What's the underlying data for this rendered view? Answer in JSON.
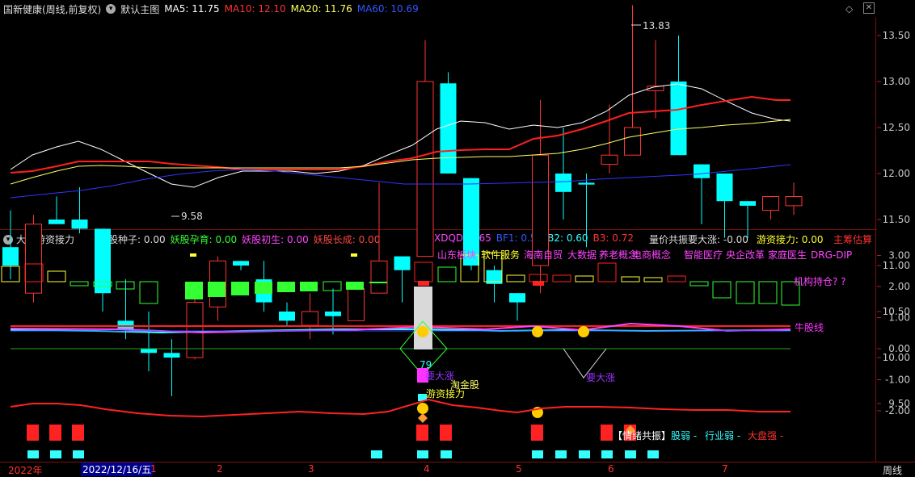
{
  "main": {
    "title": "国新健康(周线,前复权)",
    "template_label": "默认主图",
    "ma5": "MA5: 11.75",
    "ma10": "MA10: 12.10",
    "ma20": "MA20: 11.76",
    "ma60": "MA60: 10.69",
    "high_label": "13.83",
    "low_label": "9.58",
    "yaxis": [
      "13.50",
      "13.00",
      "12.50",
      "12.00",
      "11.50",
      "11.00",
      "10.50",
      "10.00",
      "9.50"
    ],
    "colors": {
      "up": "#ff3333",
      "down": "#00ffff",
      "ma5": "#ffffff",
      "ma10": "#ff2020",
      "ma20": "#ffff66",
      "ma60": "#3333ff"
    }
  },
  "sub": {
    "title": "大盘游资接力",
    "items": [
      {
        "label": "妖股种子: 0.00",
        "color": "#dddddd"
      },
      {
        "label": "妖股孕育: 0.00",
        "color": "#33ff33"
      },
      {
        "label": "妖股初生: 0.00",
        "color": "#ff44ff"
      },
      {
        "label": "妖股长成: 0.00",
        "color": "#ff4444"
      }
    ],
    "items2": [
      {
        "label": "XDQD: 0.65",
        "color": "#ff44ff"
      },
      {
        "label": "BF1: 0.50",
        "color": "#3355ff"
      },
      {
        "label": "B2: 0.60",
        "color": "#33ffff"
      },
      {
        "label": "B3: 0.72",
        "color": "#ff3333"
      }
    ],
    "right_items": [
      {
        "label": "量价共振要大涨: -0.00",
        "color": "#dddddd"
      },
      {
        "label": "游资接力: 0.00",
        "color": "#ffff33"
      }
    ],
    "main_chip": "主筹估算",
    "yaxis": [
      "3.00",
      "2.00",
      "1.00",
      "0.00",
      "-1.00",
      "-2.00"
    ],
    "concepts": [
      {
        "text": "山东板块",
        "color": "#ff44ff"
      },
      {
        "text": "软件服务",
        "color": "#ffff33"
      },
      {
        "text": "海南自贸",
        "color": "#ff44ff"
      },
      {
        "text": "大数据",
        "color": "#ff44ff"
      },
      {
        "text": "养老概念",
        "color": "#ff44ff"
      },
      {
        "text": "电商概念",
        "color": "#ff44ff"
      },
      {
        "text": "智能医疗",
        "color": "#ff44ff"
      },
      {
        "text": "央企改革",
        "color": "#ff44ff"
      },
      {
        "text": "家庭医生",
        "color": "#ff44ff"
      },
      {
        "text": "DRG-DIP",
        "color": "#ff44ff"
      }
    ],
    "jigou": "机构持仓? ?",
    "niu": "牛股线",
    "num79": "79",
    "yao1": "要大涨",
    "yao2": "要大涨",
    "taojin": "淘金股",
    "youzi": "游资接力",
    "qingxu": "【情绪共振】",
    "gu_ruo": "股弱 -",
    "hangye_ruo": "行业弱 -",
    "dapan_qiang": "大盘强 -"
  },
  "timeline": {
    "year": "2022年",
    "cursor_date": "2022/12/16/五",
    "months": [
      "1",
      "2",
      "3",
      "4",
      "5",
      "6",
      "7"
    ],
    "period": "周线"
  }
}
